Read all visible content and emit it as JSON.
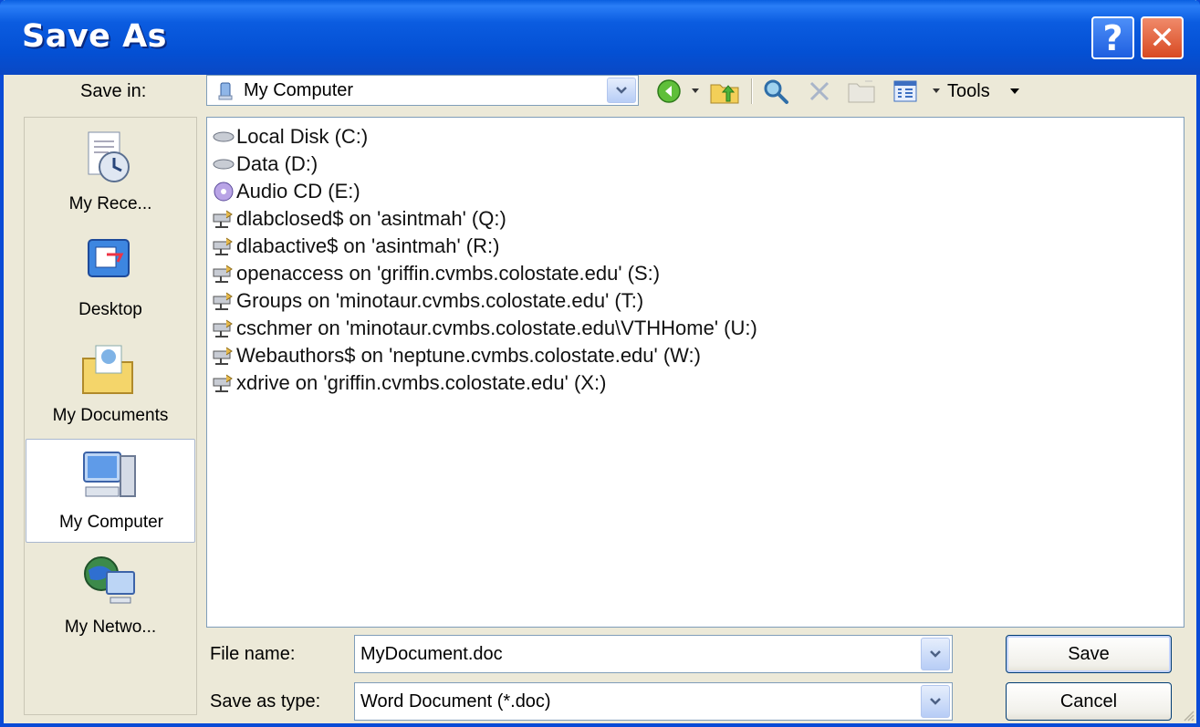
{
  "window": {
    "title": "Save As"
  },
  "titlebar": {
    "help_label": "?",
    "close_label": "✕"
  },
  "save_in": {
    "label": "Save in:",
    "value": "My Computer"
  },
  "toolbar": {
    "tools_label": "Tools"
  },
  "places": [
    {
      "label": "My Rece...",
      "icon": "recent-documents-icon"
    },
    {
      "label": "Desktop",
      "icon": "desktop-icon"
    },
    {
      "label": "My Documents",
      "icon": "my-documents-folder-icon"
    },
    {
      "label": "My Computer",
      "icon": "my-computer-icon",
      "selected": true
    },
    {
      "label": "My Netwo...",
      "icon": "network-places-icon"
    }
  ],
  "drives": [
    {
      "label": "Local Disk (C:)",
      "icon": "hard-drive-icon"
    },
    {
      "label": "Data (D:)",
      "icon": "hard-drive-icon"
    },
    {
      "label": "Audio CD (E:)",
      "icon": "cd-drive-icon"
    },
    {
      "label": "dlabclosed$ on 'asintmah' (Q:)",
      "icon": "network-drive-icon"
    },
    {
      "label": "dlabactive$ on 'asintmah' (R:)",
      "icon": "network-drive-icon"
    },
    {
      "label": "openaccess on 'griffin.cvmbs.colostate.edu' (S:)",
      "icon": "network-drive-icon"
    },
    {
      "label": "Groups on 'minotaur.cvmbs.colostate.edu' (T:)",
      "icon": "network-drive-icon"
    },
    {
      "label": "cschmer on 'minotaur.cvmbs.colostate.edu\\VTHHome' (U:)",
      "icon": "network-drive-icon"
    },
    {
      "label": "Webauthors$ on 'neptune.cvmbs.colostate.edu' (W:)",
      "icon": "network-drive-icon"
    },
    {
      "label": "xdrive on 'griffin.cvmbs.colostate.edu' (X:)",
      "icon": "network-drive-icon"
    }
  ],
  "file_name": {
    "label": "File name:",
    "value": "MyDocument.doc"
  },
  "save_type": {
    "label": "Save as type:",
    "value": "Word Document (*.doc)"
  },
  "buttons": {
    "save": "Save",
    "cancel": "Cancel"
  },
  "colors": {
    "titlebar": "#0450d4",
    "close": "#d84a22",
    "face": "#ece9d8"
  }
}
